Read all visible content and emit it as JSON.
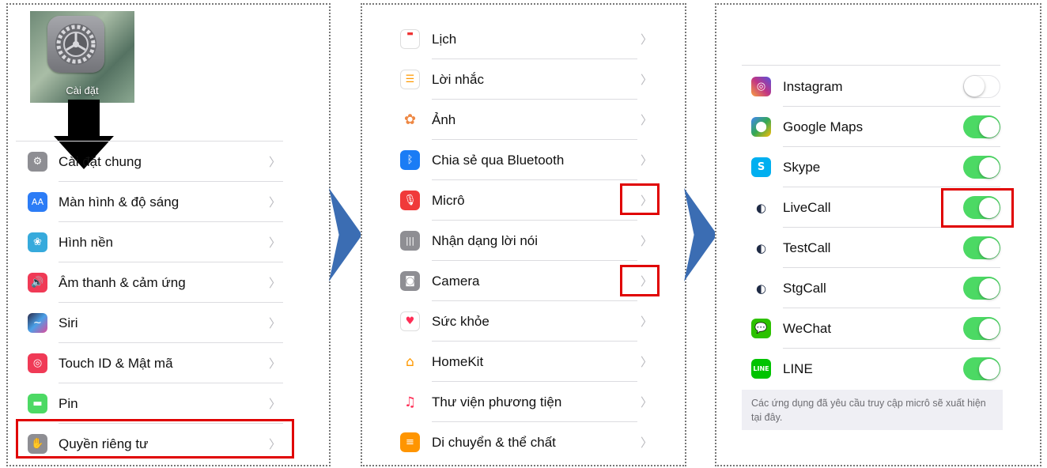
{
  "step1": {
    "app_icon_label": "Cài đặt",
    "items": [
      {
        "label": "Cài đặt chung",
        "icon": "gear-icon",
        "color": "#8e8e93"
      },
      {
        "label": "Màn hình & độ sáng",
        "icon": "aa-icon",
        "color": "#2c7cf6"
      },
      {
        "label": "Hình nền",
        "icon": "flower-wallpaper-icon",
        "color": "#36aadc"
      },
      {
        "label": "Âm thanh & cảm ứng",
        "icon": "speaker-icon",
        "color": "#f03a56"
      },
      {
        "label": "Siri",
        "icon": "siri-icon",
        "color": "#2a2a4a"
      },
      {
        "label": "Touch ID & Mật mã",
        "icon": "fingerprint-icon",
        "color": "#f03a56"
      },
      {
        "label": "Pin",
        "icon": "battery-icon",
        "color": "#4cd964"
      },
      {
        "label": "Quyền riêng tư",
        "icon": "hand-icon",
        "color": "#8e8e93"
      }
    ]
  },
  "step2": {
    "items": [
      {
        "label": "Lịch",
        "icon": "calendar-icon",
        "color": "#ffffff"
      },
      {
        "label": "Lời nhắc",
        "icon": "reminders-icon",
        "color": "#ffffff"
      },
      {
        "label": "Ảnh",
        "icon": "photos-icon",
        "color": "#ffffff"
      },
      {
        "label": "Chia sẻ qua Bluetooth",
        "icon": "bluetooth-icon",
        "color": "#1a7cf5"
      },
      {
        "label": "Micrô",
        "icon": "microphone-icon",
        "color": "#f03a3a"
      },
      {
        "label": "Nhận dạng lời nói",
        "icon": "waveform-icon",
        "color": "#8e8e93"
      },
      {
        "label": "Camera",
        "icon": "camera-icon",
        "color": "#8e8e93"
      },
      {
        "label": "Sức khỏe",
        "icon": "heart-icon",
        "color": "#ffffff"
      },
      {
        "label": "HomeKit",
        "icon": "home-icon",
        "color": "#ffffff"
      },
      {
        "label": "Thư viện phương tiện",
        "icon": "music-note-icon",
        "color": "#ffffff"
      },
      {
        "label": "Di chuyển & thể chất",
        "icon": "motion-icon",
        "color": "#ff9500"
      }
    ]
  },
  "step3": {
    "apps": [
      {
        "label": "Instagram",
        "icon": "instagram-icon",
        "color": "#c13584",
        "enabled": false
      },
      {
        "label": "Google Maps",
        "icon": "google-maps-icon",
        "color": "#34a853",
        "enabled": true
      },
      {
        "label": "Skype",
        "icon": "skype-icon",
        "color": "#00aff0",
        "enabled": true
      },
      {
        "label": "LiveCall",
        "icon": "livecall-icon",
        "color": "#1f2b45",
        "enabled": true
      },
      {
        "label": "TestCall",
        "icon": "testcall-icon",
        "color": "#1f2b45",
        "enabled": true
      },
      {
        "label": "StgCall",
        "icon": "stgcall-icon",
        "color": "#1f2b45",
        "enabled": true
      },
      {
        "label": "WeChat",
        "icon": "wechat-icon",
        "color": "#2dc100",
        "enabled": true
      },
      {
        "label": "LINE",
        "icon": "line-icon",
        "color": "#00c300",
        "enabled": true
      }
    ],
    "footer": "Các ứng dụng đã yêu cầu truy cập micrô sẽ xuất hiện tại đây."
  },
  "colors": {
    "toggle_on": "#4cd964",
    "highlight": "#e00000",
    "step_arrow": "#3b6db3"
  }
}
